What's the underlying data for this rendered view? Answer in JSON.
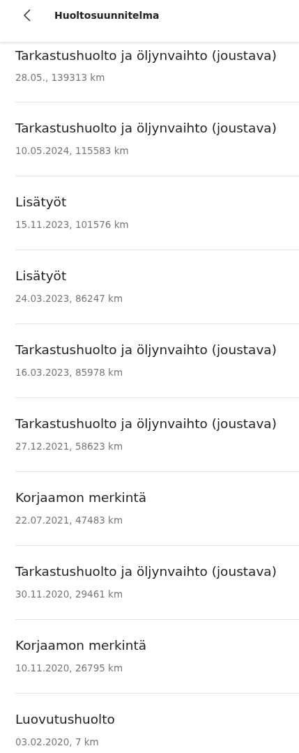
{
  "header": {
    "title": "Huoltosuunnitelma"
  },
  "entries": [
    {
      "title": "Tarkastushuolto ja öljynvaihto (joustava)",
      "detail": "28.05., 139313 km"
    },
    {
      "title": "Tarkastushuolto ja öljynvaihto (joustava)",
      "detail": "10.05.2024, 115583 km"
    },
    {
      "title": "Lisätyöt",
      "detail": "15.11.2023, 101576 km"
    },
    {
      "title": "Lisätyöt",
      "detail": "24.03.2023, 86247 km"
    },
    {
      "title": "Tarkastushuolto ja öljynvaihto (joustava)",
      "detail": "16.03.2023, 85978 km"
    },
    {
      "title": "Tarkastushuolto ja öljynvaihto (joustava)",
      "detail": "27.12.2021, 58623 km"
    },
    {
      "title": "Korjaamon merkintä",
      "detail": "22.07.2021, 47483 km"
    },
    {
      "title": "Tarkastushuolto ja öljynvaihto (joustava)",
      "detail": "30.11.2020, 29461 km"
    },
    {
      "title": "Korjaamon merkintä",
      "detail": "10.11.2020, 26795 km"
    },
    {
      "title": "Luovutushuolto",
      "detail": "03.02.2020, 7 km"
    }
  ]
}
